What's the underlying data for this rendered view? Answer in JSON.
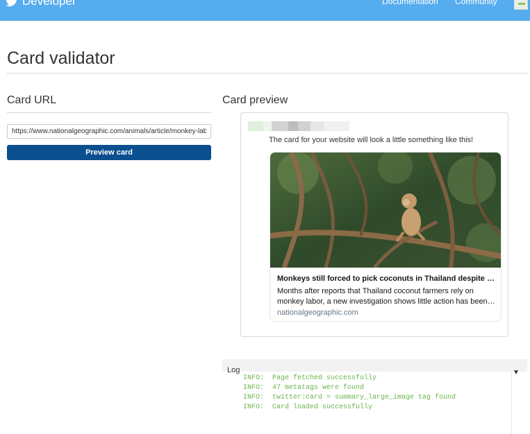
{
  "header": {
    "brand": "Developer",
    "nav": [
      "Documentation",
      "Community"
    ]
  },
  "page": {
    "title": "Card validator"
  },
  "card_url": {
    "heading": "Card URL",
    "value": "https://www.nationalgeographic.com/animals/article/monkey-labor",
    "button_label": "Preview card"
  },
  "card_preview": {
    "heading": "Card preview",
    "caption": "The card for your website will look a little something like this!",
    "card": {
      "title": "Monkeys still forced to pick coconuts in Thailand despite c...",
      "description_lines": [
        "Months after reports that Thailand coconut farmers rely on",
        "monkey labor, a new investigation shows little action has been ..."
      ],
      "domain": "nationalgeographic.com"
    }
  },
  "log": {
    "label": "Log",
    "toggle_icon": "triangle-down-icon",
    "lines": [
      "INFO:  Page fetched successfully",
      "INFO:  47 metatags were found",
      "INFO:  twitter:card = summary_large_image tag found",
      "INFO:  Card loaded successfully"
    ]
  },
  "colors": {
    "topbar": "#55acee",
    "button": "#0b4f8f",
    "log_text": "#69b54a"
  }
}
